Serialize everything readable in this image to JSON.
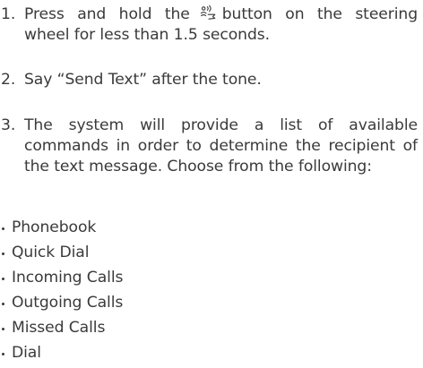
{
  "steps": [
    {
      "number": "1.",
      "text_before_icon": "Press and hold the",
      "icon": "voice-talk-icon",
      "text_after_icon": "button on the steering wheel for less than 1.5 seconds."
    },
    {
      "number": "2.",
      "text": "Say “Send Text” after the tone."
    },
    {
      "number": "3.",
      "text": "The system will provide a list of available commands in order to determine the recipient of the text message. Choose from the following:"
    }
  ],
  "options": [
    "Phonebook",
    "Quick Dial",
    "Incoming Calls",
    "Outgoing Calls",
    "Missed Calls",
    "Dial"
  ],
  "colors": {
    "text": "#3a3a3a",
    "background": "#ffffff"
  }
}
